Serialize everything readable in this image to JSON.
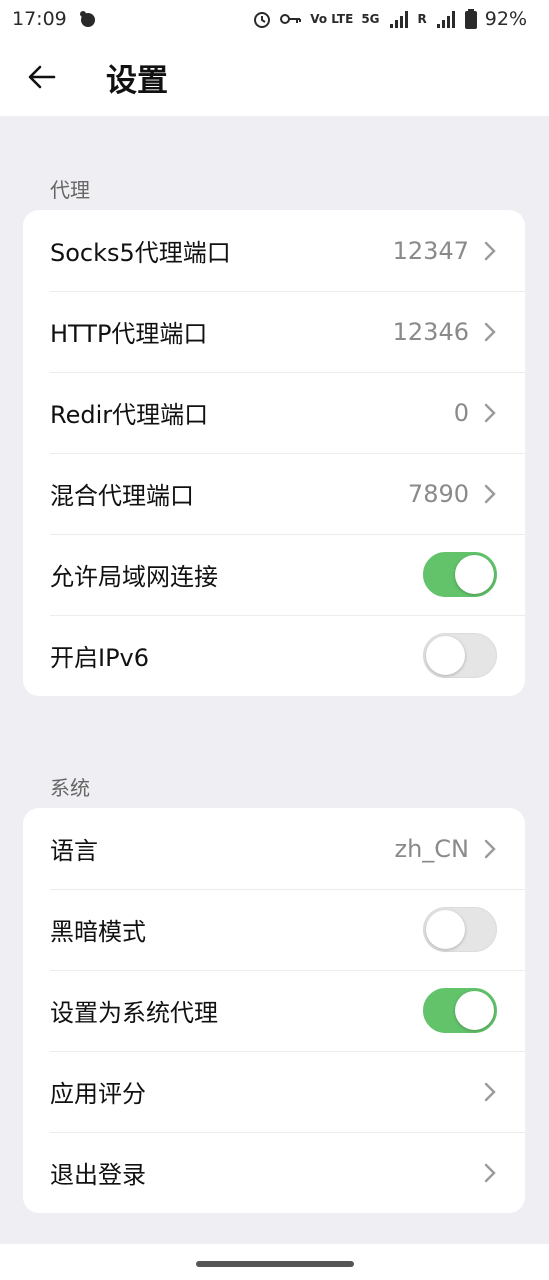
{
  "status_bar": {
    "time": "17:09",
    "volte": "Vo LTE",
    "network": "5G",
    "roaming": "R",
    "battery": "92%"
  },
  "app_bar": {
    "title": "设置"
  },
  "sections": [
    {
      "label": "代理",
      "items": [
        {
          "label": "Socks5代理端口",
          "value": "12347",
          "type": "nav"
        },
        {
          "label": "HTTP代理端口",
          "value": "12346",
          "type": "nav"
        },
        {
          "label": "Redir代理端口",
          "value": "0",
          "type": "nav"
        },
        {
          "label": "混合代理端口",
          "value": "7890",
          "type": "nav"
        },
        {
          "label": "允许局域网连接",
          "on": true,
          "type": "toggle"
        },
        {
          "label": "开启IPv6",
          "on": false,
          "type": "toggle"
        }
      ]
    },
    {
      "label": "系统",
      "items": [
        {
          "label": "语言",
          "value": "zh_CN",
          "type": "nav"
        },
        {
          "label": "黑暗模式",
          "on": false,
          "type": "toggle"
        },
        {
          "label": "设置为系统代理",
          "on": true,
          "type": "toggle"
        },
        {
          "label": "应用评分",
          "value": "",
          "type": "nav"
        },
        {
          "label": "退出登录",
          "value": "",
          "type": "nav"
        }
      ]
    }
  ],
  "colors": {
    "toggle_on": "#62c36b",
    "background": "#efeff3"
  }
}
